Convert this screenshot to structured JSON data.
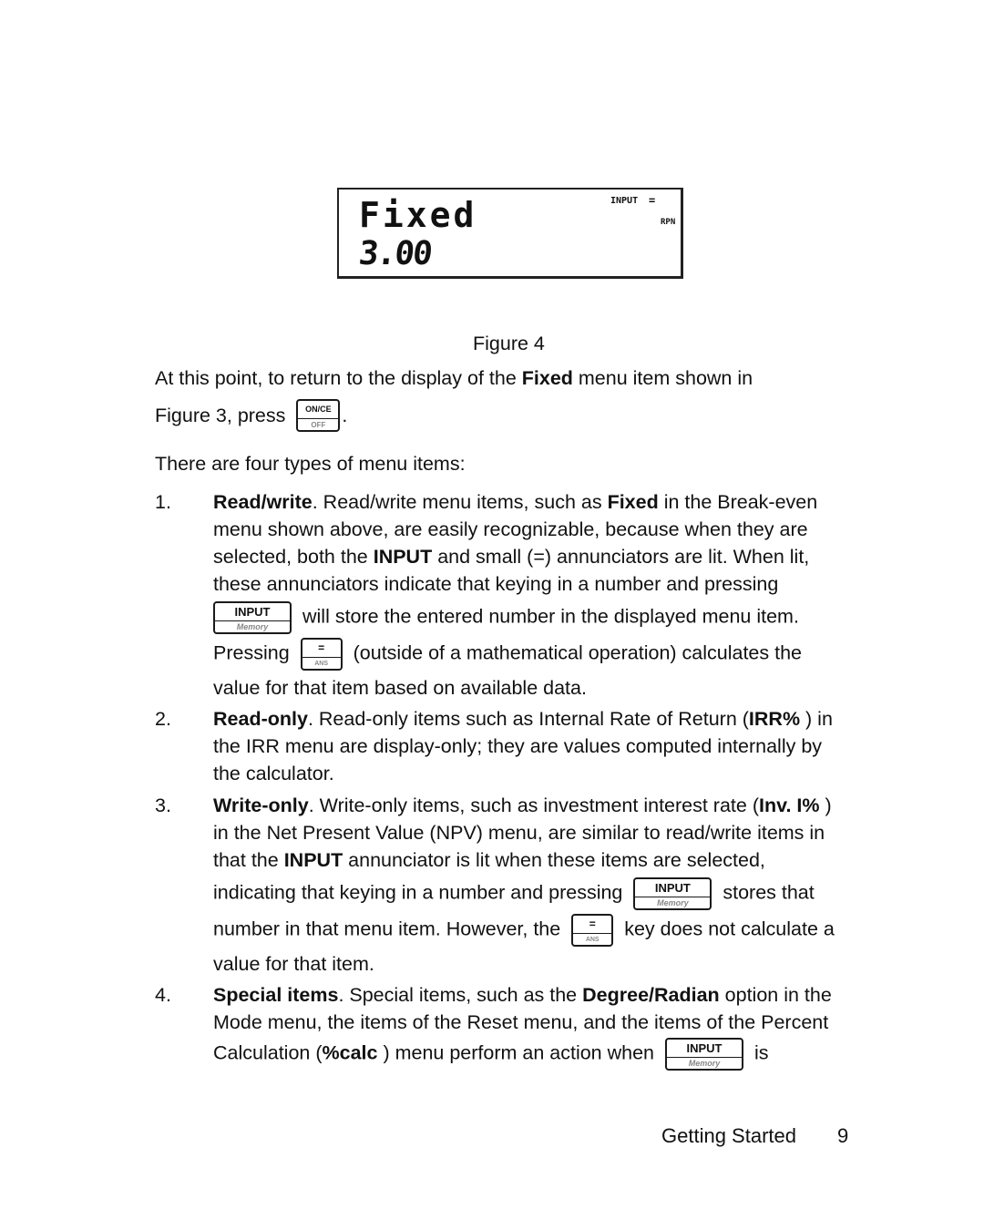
{
  "figure": {
    "lcd": {
      "menu_item": "Fixed",
      "value": "3.00",
      "annunciator_input": "INPUT",
      "annunciator_equals": "=",
      "annunciator_rpn": "RPN"
    },
    "caption": "Figure 4"
  },
  "intro": {
    "line1_pre": "At this point, to return to the display of the ",
    "line1_bold": "Fixed",
    "line1_post": " menu item shown in",
    "line2_pre": "Figure 3, press",
    "line2_post": "."
  },
  "keys": {
    "oncе_top": "ON/CE",
    "on_top": "ON/CE",
    "on_bottom": "OFF",
    "input_top": "INPUT",
    "input_bottom": "Memory",
    "eq_top": "=",
    "eq_bottom": "ANS"
  },
  "types_intro": "There are four types of menu items:",
  "items": [
    {
      "number": "1.",
      "title": "Read/write",
      "lines": {
        "l1_post_title": ". Read/write menu items, such as ",
        "l1_bold": "Fixed",
        "l1_end": " in the Break-even",
        "l2": "menu shown above, are easily recognizable, because when they are",
        "l3_pre": "selected, both the ",
        "l3_bold": "INPUT",
        "l3_post": " and small (=) annunciators are lit. When lit,",
        "l4": "these annunciators indicate that keying in a number and pressing",
        "l5_post": "will store the entered number in the displayed menu item.",
        "l6_pre": "Pressing",
        "l6_post": "(outside of a mathematical operation) calculates the",
        "l7": "value for that item based on available data."
      }
    },
    {
      "number": "2.",
      "title": "Read-only",
      "lines": {
        "l1_post_title": ". Read-only items such as Internal Rate of Return (",
        "l1_bold": "IRR%",
        "l1_end": " ) in",
        "l2": "the IRR menu are display-only; they are values computed internally by",
        "l3": "the calculator."
      }
    },
    {
      "number": "3.",
      "title": "Write-only",
      "lines": {
        "l1_post_title": ". Write-only items, such as investment interest rate (",
        "l1_bold": "Inv. I%",
        "l1_end": " )",
        "l2": "in the Net Present Value (NPV) menu, are similar to read/write items in",
        "l3_pre": "that the ",
        "l3_bold": "INPUT",
        "l3_post": " annunciator is lit when these items are selected,",
        "l4_pre": "indicating that keying in a number and pressing",
        "l4_post": "stores that",
        "l5_pre": "number in that menu item. However, the",
        "l5_post": "key does not calculate a",
        "l6": "value for that item."
      }
    },
    {
      "number": "4.",
      "title": "Special items",
      "lines": {
        "l1_post_title": ". Special items, such as the ",
        "l1_bold": "Degree/Radian",
        "l1_end": " option in the",
        "l2": "Mode menu, the items of the Reset menu, and the items of the Percent",
        "l3_pre": "Calculation (",
        "l3_bold": "%calc",
        "l3_mid": " ) menu perform an action when",
        "l3_post": "is"
      }
    }
  ],
  "footer": {
    "section": "Getting Started",
    "page_number": "9"
  }
}
